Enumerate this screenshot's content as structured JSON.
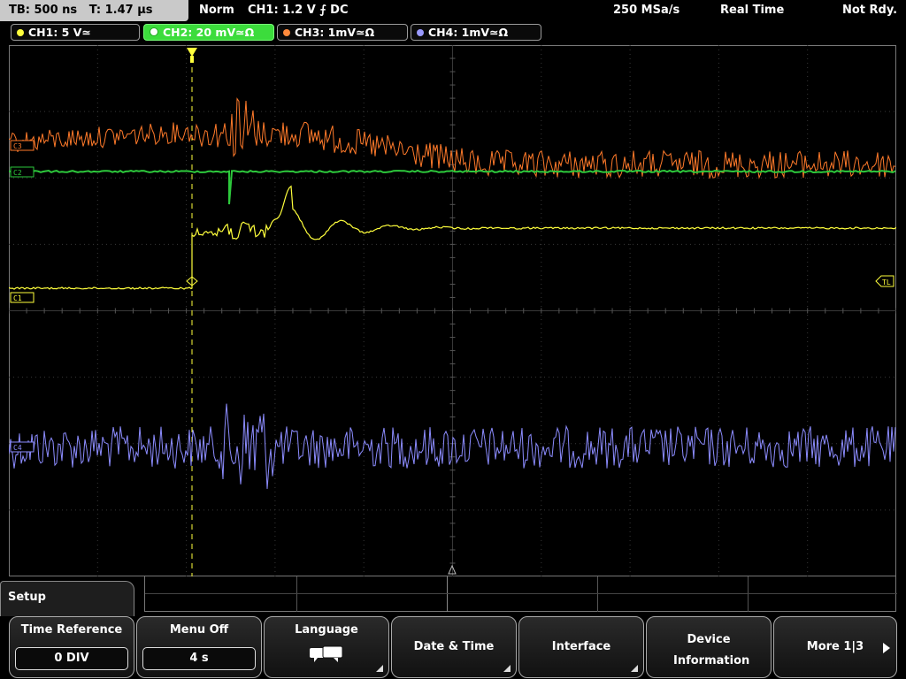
{
  "status_bar": {
    "timebase": "TB: 500 ns",
    "trigger_time": "T: 1.47 µs",
    "mode": "Norm",
    "trigger": "CH1: 1.2 V ⨍ DC",
    "sample_rate": "250 MSa/s",
    "acquisition": "Real Time",
    "state": "Not Rdy."
  },
  "channels": [
    {
      "label": "CH1: 5 V≃",
      "color": "#ffff3c",
      "active": false
    },
    {
      "label": "CH2: 20 mV≃Ω",
      "color": "#2dc93c",
      "active": true
    },
    {
      "label": "CH3: 1mV≃Ω",
      "color": "#ff8a3c",
      "active": false
    },
    {
      "label": "CH4: 1mV≃Ω",
      "color": "#9a9aff",
      "active": false
    }
  ],
  "markers": {
    "ch1": "C1",
    "ch2": "C2",
    "ch3": "C3",
    "ch4": "C4",
    "trigger_level": "TL"
  },
  "colors": {
    "ch1": "#ffff3c",
    "ch2": "#2dc93c",
    "ch3": "#ff7a2a",
    "ch4": "#8c8cff",
    "grid": "#3a3a3a",
    "trigger_marker": "#ffff3c"
  },
  "menu": {
    "title": "Setup",
    "softkeys": [
      {
        "label": "Time Reference",
        "value": "0 DIV"
      },
      {
        "label": "Menu Off",
        "value": "4 s"
      },
      {
        "label": "Language",
        "icon": "speech-bubbles-icon"
      },
      {
        "label": "Date & Time"
      },
      {
        "label": "Interface"
      },
      {
        "label": "Device Information"
      },
      {
        "label": "More 1|3"
      }
    ]
  }
}
